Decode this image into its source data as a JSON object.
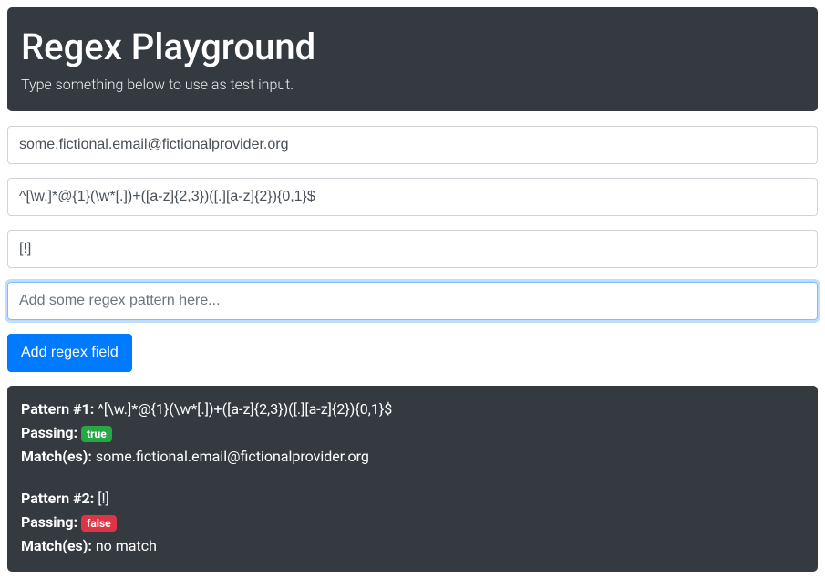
{
  "header": {
    "title": "Regex Playground",
    "subtitle": "Type something below to use as test input."
  },
  "inputs": {
    "test_string": "some.fictional.email@fictionalprovider.org",
    "patterns": [
      "^[\\w.]*@{1}(\\w*[.])+([a-z]{2,3})([.][a-z]{2}){0,1}$",
      "[!]",
      ""
    ],
    "pattern_placeholder": "Add some regex pattern here..."
  },
  "buttons": {
    "add_regex": "Add regex field"
  },
  "labels": {
    "pattern_prefix": "Pattern #",
    "passing": "Passing:",
    "matches": "Match(es):"
  },
  "results": [
    {
      "index": "1",
      "pattern": "^[\\w.]*@{1}(\\w*[.])+([a-z]{2,3})([.][a-z]{2}){0,1}$",
      "passing": "true",
      "passing_class": "badge-success",
      "matches": "some.fictional.email@fictionalprovider.org"
    },
    {
      "index": "2",
      "pattern": "[!]",
      "passing": "false",
      "passing_class": "badge-danger",
      "matches": "no match"
    }
  ]
}
